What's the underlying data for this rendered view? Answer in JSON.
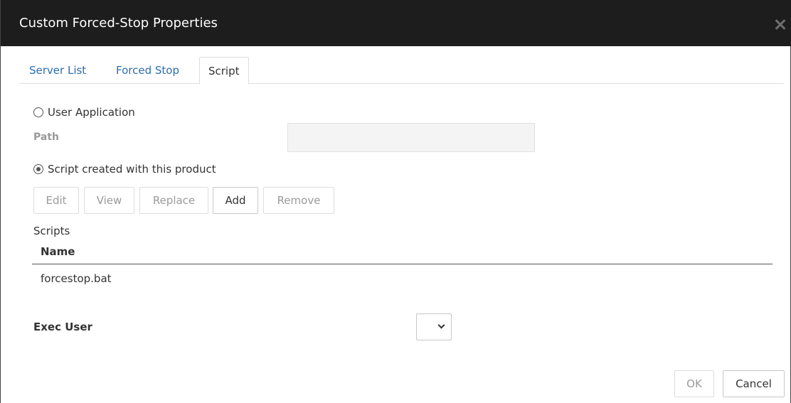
{
  "dialog": {
    "title": "Custom Forced-Stop Properties",
    "close_icon": "close-icon"
  },
  "tabs": [
    {
      "label": "Server List",
      "active": false
    },
    {
      "label": "Forced Stop",
      "active": false
    },
    {
      "label": "Script",
      "active": true
    }
  ],
  "script_tab": {
    "user_application": {
      "label": "User Application",
      "selected": false
    },
    "path": {
      "label": "Path",
      "value": ""
    },
    "script_product": {
      "label": "Script created with this product",
      "selected": true
    },
    "buttons": {
      "edit": "Edit",
      "view": "View",
      "replace": "Replace",
      "add": "Add",
      "remove": "Remove"
    },
    "scripts_label": "Scripts",
    "table": {
      "columns": [
        "Name"
      ],
      "rows": [
        [
          "forcestop.bat"
        ]
      ]
    },
    "exec_user": {
      "label": "Exec User",
      "value": ""
    }
  },
  "footer": {
    "ok": "OK",
    "cancel": "Cancel"
  },
  "colors": {
    "titlebar": "#1d1d1d",
    "link_tab": "#2a6db0"
  }
}
